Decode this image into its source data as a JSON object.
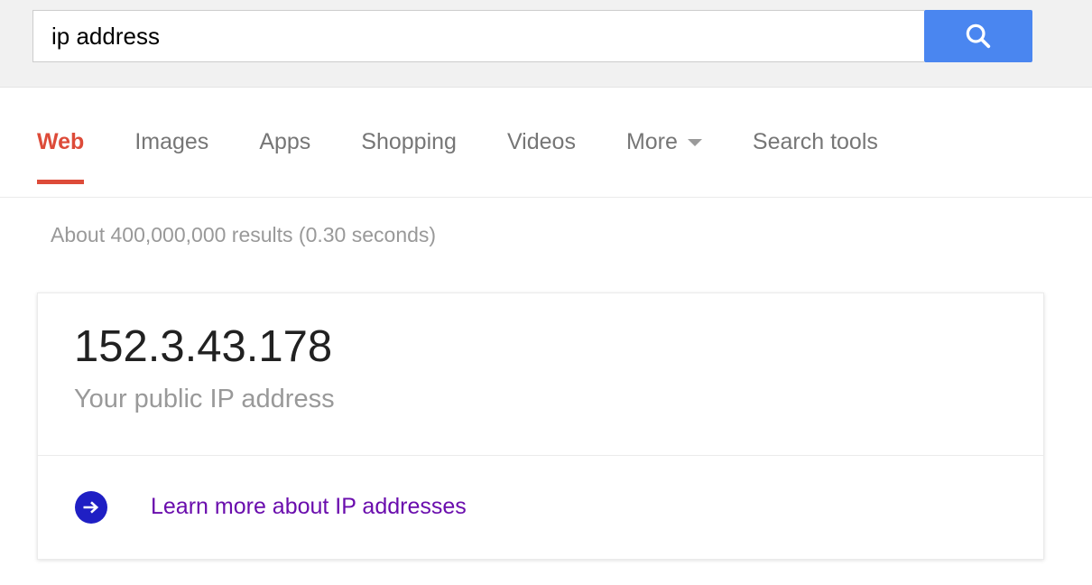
{
  "search": {
    "query": "ip address",
    "placeholder": "Search",
    "button_icon": "search-icon",
    "button_color": "#4a86f0"
  },
  "nav": {
    "items": [
      {
        "label": "Web",
        "active": true
      },
      {
        "label": "Images",
        "active": false
      },
      {
        "label": "Apps",
        "active": false
      },
      {
        "label": "Shopping",
        "active": false
      },
      {
        "label": "Videos",
        "active": false
      },
      {
        "label": "More",
        "active": false,
        "caret": true
      },
      {
        "label": "Search tools",
        "active": false
      }
    ],
    "active_color": "#dd4b39",
    "inactive_color": "#767676"
  },
  "results": {
    "stats": "About 400,000,000 results (0.30 seconds)"
  },
  "ip_card": {
    "address": "152.3.43.178",
    "caption": "Your public IP address",
    "link_text": "Learn more about IP addresses",
    "link_color": "#6a0dad",
    "link_icon": "circle-arrow-right-icon",
    "link_icon_color": "#1f1fc4"
  }
}
